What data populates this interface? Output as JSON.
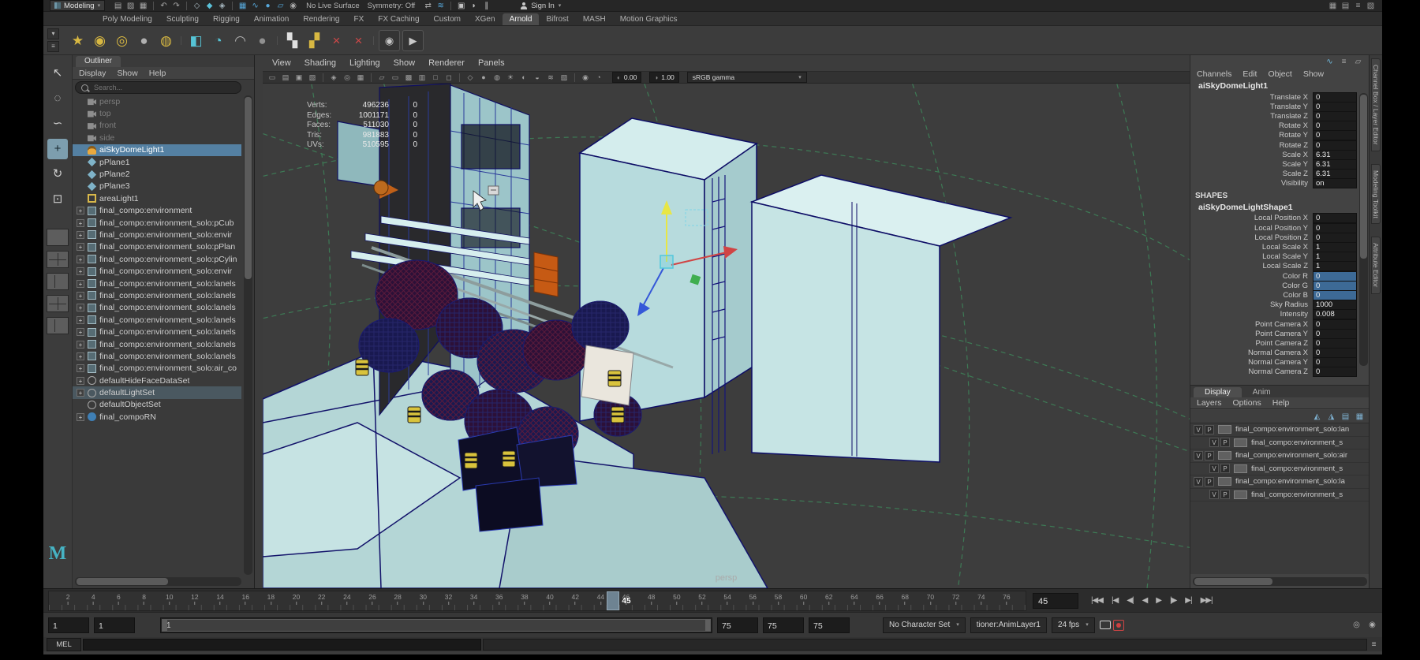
{
  "titlebar": {
    "workspace_selector": "Modeling",
    "no_live_surface": "No Live Surface",
    "symmetry_label": "Symmetry: Off",
    "sign_in_label": "Sign In"
  },
  "titlebar_icons_left": [
    {
      "name": "new-scene-icon",
      "glyph": "▤",
      "color": "#a8a8a8"
    },
    {
      "name": "open-scene-icon",
      "glyph": "▨",
      "color": "#a8a8a8"
    },
    {
      "name": "save-scene-icon",
      "glyph": "▦",
      "color": "#a8a8a8"
    },
    {
      "sep": true
    },
    {
      "name": "undo-icon",
      "glyph": "↶",
      "color": "#a8a8a8"
    },
    {
      "name": "redo-icon",
      "glyph": "↷",
      "color": "#a8a8a8"
    },
    {
      "sep": true
    },
    {
      "name": "select-by-hierarchy-icon",
      "glyph": "◇",
      "color": "#a8b8c0"
    },
    {
      "name": "select-by-object-icon",
      "glyph": "◆",
      "color": "#5bc1d8"
    },
    {
      "name": "select-by-component-icon",
      "glyph": "◈",
      "color": "#a8b8c0"
    },
    {
      "sep": true
    },
    {
      "name": "snap-to-grid-icon",
      "glyph": "▦",
      "color": "#57a9dc"
    },
    {
      "name": "snap-to-curve-icon",
      "glyph": "∿",
      "color": "#57a9dc"
    },
    {
      "name": "snap-to-point-icon",
      "glyph": "●",
      "color": "#57a9dc"
    },
    {
      "name": "snap-to-view-plane-icon",
      "glyph": "▱",
      "color": "#57a9dc"
    },
    {
      "name": "make-live-icon",
      "glyph": "◉",
      "color": "#a8a8a8"
    }
  ],
  "titlebar_icons_mid": [
    {
      "name": "input-connections-icon",
      "glyph": "⇄",
      "color": "#a8a8a8"
    },
    {
      "name": "construction-history-icon",
      "glyph": "≋",
      "color": "#57a9dc"
    },
    {
      "sep": true
    },
    {
      "name": "open-render-view-icon",
      "glyph": "▣",
      "color": "#c4c4c4"
    },
    {
      "name": "render-current-frame-icon",
      "glyph": "◗",
      "color": "#c4c4c4"
    },
    {
      "name": "ipr-render-icon",
      "glyph": "∥",
      "color": "#c4c4c4"
    }
  ],
  "titlebar_icons_right": [
    {
      "name": "layout-grid-icon",
      "glyph": "▦",
      "color": "#a0a0a0"
    },
    {
      "name": "ui-elements-icon",
      "glyph": "▤",
      "color": "#a0a0a0"
    },
    {
      "name": "hotbox-controls-icon",
      "glyph": "≡",
      "color": "#a0a0a0"
    },
    {
      "name": "workspace-icon",
      "glyph": "▧",
      "color": "#a0a0a0"
    }
  ],
  "shelf": {
    "tabs": [
      "Poly Modeling",
      "Sculpting",
      "Rigging",
      "Animation",
      "Rendering",
      "FX",
      "FX Caching",
      "Custom",
      "XGen",
      "Arnold",
      "Bifrost",
      "MASH",
      "Motion Graphics"
    ],
    "active_tab": "Arnold",
    "switch_icons": [
      {
        "name": "shelf-tab-selector-icon",
        "glyph": "▾",
        "color": "#bbbbbb"
      },
      {
        "name": "shelf-menu-icon",
        "glyph": "≡",
        "color": "#bbbbbb"
      }
    ],
    "icons": [
      {
        "name": "poly-sphere-shelf-icon",
        "glyph": "★",
        "color": "#d8b842"
      },
      {
        "name": "poly-cube-shelf-icon",
        "glyph": "◉",
        "color": "#d8b842"
      },
      {
        "name": "poly-torus-shelf-icon",
        "glyph": "◎",
        "color": "#d8b842"
      },
      {
        "name": "poly-plane-shelf-icon",
        "glyph": "●",
        "color": "#b0b0b0"
      },
      {
        "name": "poly-cylinder-shelf-icon",
        "glyph": "◍",
        "color": "#d8b842"
      },
      {
        "sep": true
      },
      {
        "name": "arnold-standin-shelf-icon",
        "glyph": "◧",
        "color": "#56c4d6"
      },
      {
        "name": "arnold-skydome-shelf-icon",
        "glyph": "◔",
        "color": "#56c4d6"
      },
      {
        "name": "arnold-curve-shelf-icon",
        "glyph": "◠",
        "color": "#b0b0b0"
      },
      {
        "name": "arnold-sphere-shelf-icon",
        "glyph": "●",
        "color": "#909090"
      },
      {
        "sep": true
      },
      {
        "name": "uv-checker-shelf-icon",
        "glyph": "▚",
        "color": "#e0e0e0"
      },
      {
        "name": "uv-checker-gold-shelf-icon",
        "glyph": "▞",
        "color": "#d8b842"
      },
      {
        "name": "delete-history-shelf-icon",
        "glyph": "×",
        "color": "#d04848"
      },
      {
        "name": "delete-nondeformer-shelf-icon",
        "glyph": "×",
        "color": "#d04848"
      },
      {
        "sep": true
      },
      {
        "name": "eye-shelf-icon",
        "glyph": "◉",
        "color": "#c8c8c8",
        "cls": "boxed"
      },
      {
        "name": "playblast-shelf-icon",
        "glyph": "▶",
        "color": "#c8c8c8",
        "cls": "boxed"
      }
    ]
  },
  "toolbox": {
    "tools": [
      {
        "name": "select-tool",
        "glyph": "↖"
      },
      {
        "name": "lasso-select-tool",
        "glyph": "◌"
      },
      {
        "name": "paint-select-tool",
        "glyph": "∽"
      },
      {
        "name": "move-tool",
        "glyph": "+"
      },
      {
        "name": "rotate-tool",
        "glyph": "↻"
      },
      {
        "name": "scale-tool",
        "glyph": "⊡"
      }
    ],
    "selected_tool": "move-tool",
    "layout_buttons": [
      {
        "name": "layout-single-pane-button"
      },
      {
        "name": "layout-four-pane-button"
      },
      {
        "name": "layout-two-pane-button"
      },
      {
        "name": "layout-persp-outliner-button"
      },
      {
        "name": "layout-hypershade-button"
      }
    ],
    "logo_text": "M"
  },
  "outliner": {
    "tab_title": "Outliner",
    "menus": [
      "Display",
      "Show",
      "Help"
    ],
    "search_placeholder": "Search...",
    "items": [
      {
        "label": "persp",
        "icon": "camera",
        "dimmed": true
      },
      {
        "label": "top",
        "icon": "camera",
        "dimmed": true
      },
      {
        "label": "front",
        "icon": "camera",
        "dimmed": true
      },
      {
        "label": "side",
        "icon": "camera",
        "dimmed": true
      },
      {
        "label": "aiSkyDomeLight1",
        "icon": "dome-light",
        "selected": true
      },
      {
        "label": "pPlane1",
        "icon": "plane"
      },
      {
        "label": "pPlane2",
        "icon": "plane"
      },
      {
        "label": "pPlane3",
        "icon": "plane"
      },
      {
        "label": "areaLight1",
        "icon": "area-light"
      },
      {
        "label": "final_compo:environment",
        "icon": "transform",
        "expandable": true
      },
      {
        "label": "final_compo:environment_solo:pCub",
        "icon": "transform",
        "expandable": true
      },
      {
        "label": "final_compo:environment_solo:envir",
        "icon": "transform",
        "expandable": true
      },
      {
        "label": "final_compo:environment_solo:pPlan",
        "icon": "transform",
        "expandable": true
      },
      {
        "label": "final_compo:environment_solo:pCylin",
        "icon": "transform",
        "expandable": true
      },
      {
        "label": "final_compo:environment_solo:envir",
        "icon": "transform",
        "expandable": true
      },
      {
        "label": "final_compo:environment_solo:lanels",
        "icon": "transform",
        "expandable": true
      },
      {
        "label": "final_compo:environment_solo:lanels",
        "icon": "transform",
        "expandable": true
      },
      {
        "label": "final_compo:environment_solo:lanels",
        "icon": "transform",
        "expandable": true
      },
      {
        "label": "final_compo:environment_solo:lanels",
        "icon": "transform",
        "expandable": true
      },
      {
        "label": "final_compo:environment_solo:lanels",
        "icon": "transform",
        "expandable": true
      },
      {
        "label": "final_compo:environment_solo:lanels",
        "icon": "transform",
        "expandable": true
      },
      {
        "label": "final_compo:environment_solo:lanels",
        "icon": "transform",
        "expandable": true
      },
      {
        "label": "final_compo:environment_solo:air_co",
        "icon": "transform",
        "expandable": true
      },
      {
        "label": "defaultHideFaceDataSet",
        "icon": "set",
        "expandable": true
      },
      {
        "label": "defaultLightSet",
        "icon": "set",
        "expandable": true,
        "highlighted": true
      },
      {
        "label": "defaultObjectSet",
        "icon": "set"
      },
      {
        "label": "final_compoRN",
        "icon": "reference",
        "expandable": true
      }
    ]
  },
  "viewport": {
    "menus": [
      "View",
      "Shading",
      "Lighting",
      "Show",
      "Renderer",
      "Panels"
    ],
    "toolbar_icons": [
      {
        "name": "camera-lock-icon",
        "glyph": "▭"
      },
      {
        "name": "camera-attributes-icon",
        "glyph": "▤"
      },
      {
        "name": "bookmarks-icon",
        "glyph": "▣"
      },
      {
        "name": "image-plane-icon",
        "glyph": "▧"
      },
      {
        "sep": true
      },
      {
        "name": "two-d-pan-zoom-icon",
        "glyph": "◈"
      },
      {
        "name": "grease-pencil-icon",
        "glyph": "◎"
      },
      {
        "name": "grid-icon",
        "glyph": "▦"
      },
      {
        "sep": true
      },
      {
        "name": "film-gate-icon",
        "glyph": "▱"
      },
      {
        "name": "resolution-gate-icon",
        "glyph": "▭"
      },
      {
        "name": "gate-mask-icon",
        "glyph": "▩"
      },
      {
        "name": "field-chart-icon",
        "glyph": "▥"
      },
      {
        "name": "safe-action-icon",
        "glyph": "□"
      },
      {
        "name": "safe-title-icon",
        "glyph": "◻"
      },
      {
        "sep": true
      },
      {
        "name": "wireframe-icon",
        "glyph": "◇"
      },
      {
        "name": "smooth-shade-icon",
        "glyph": "●"
      },
      {
        "name": "textured-icon",
        "glyph": "◍"
      },
      {
        "name": "use-all-lights-icon",
        "glyph": "☀"
      },
      {
        "name": "shadows-icon",
        "glyph": "◐"
      },
      {
        "name": "screen-space-ao-icon",
        "glyph": "◒"
      },
      {
        "name": "motion-blur-icon",
        "glyph": "≋"
      },
      {
        "name": "multisample-icon",
        "glyph": "▨"
      },
      {
        "sep": true
      },
      {
        "name": "isolate-select-icon",
        "glyph": "◉"
      },
      {
        "name": "xray-icon",
        "glyph": "◔"
      }
    ],
    "toolbar_fields": {
      "exposure": "0.00",
      "gamma": "1.00",
      "view_transform": "sRGB gamma"
    },
    "hud": [
      {
        "label": "Verts:",
        "value": "496236",
        "selected": "0"
      },
      {
        "label": "Edges:",
        "value": "1001171",
        "selected": "0"
      },
      {
        "label": "Faces:",
        "value": "511030",
        "selected": "0"
      },
      {
        "label": "Tris:",
        "value": "981883",
        "selected": "0"
      },
      {
        "label": "UVs:",
        "value": "510595",
        "selected": "0"
      }
    ],
    "camera_label": "persp"
  },
  "channel_box": {
    "header_icons": [
      {
        "name": "channel-stats-icon",
        "glyph": "∿",
        "color": "#6fb6d8"
      },
      {
        "name": "channel-settings-icon",
        "glyph": "≡",
        "color": "#a8a8a8"
      },
      {
        "name": "channel-pin-icon",
        "glyph": "▱",
        "color": "#a8a8a8"
      }
    ],
    "menus": [
      "Channels",
      "Edit",
      "Object",
      "Show"
    ],
    "node_name": "aiSkyDomeLight1",
    "attributes": [
      {
        "name": "Translate X",
        "value": "0"
      },
      {
        "name": "Translate Y",
        "value": "0"
      },
      {
        "name": "Translate Z",
        "value": "0"
      },
      {
        "name": "Rotate X",
        "value": "0"
      },
      {
        "name": "Rotate Y",
        "value": "0"
      },
      {
        "name": "Rotate Z",
        "value": "0"
      },
      {
        "name": "Scale X",
        "value": "6.31"
      },
      {
        "name": "Scale Y",
        "value": "6.31"
      },
      {
        "name": "Scale Z",
        "value": "6.31"
      },
      {
        "name": "Visibility",
        "value": "on"
      }
    ],
    "shapes_heading": "SHAPES",
    "shape_node_name": "aiSkyDomeLightShape1",
    "shape_attributes": [
      {
        "name": "Local Position X",
        "value": "0"
      },
      {
        "name": "Local Position Y",
        "value": "0"
      },
      {
        "name": "Local Position Z",
        "value": "0"
      },
      {
        "name": "Local Scale X",
        "value": "1"
      },
      {
        "name": "Local Scale Y",
        "value": "1"
      },
      {
        "name": "Local Scale Z",
        "value": "1"
      },
      {
        "name": "Color R",
        "value": "0",
        "highlight": true
      },
      {
        "name": "Color G",
        "value": "0",
        "highlight": true
      },
      {
        "name": "Color B",
        "value": "0",
        "highlight": true
      },
      {
        "name": "Sky Radius",
        "value": "1000"
      },
      {
        "name": "Intensity",
        "value": "0.008"
      },
      {
        "name": "Point Camera X",
        "value": "0"
      },
      {
        "name": "Point Camera Y",
        "value": "0"
      },
      {
        "name": "Point Camera Z",
        "value": "0"
      },
      {
        "name": "Normal Camera X",
        "value": "0"
      },
      {
        "name": "Normal Camera Y",
        "value": "0"
      },
      {
        "name": "Normal Camera Z",
        "value": "0"
      }
    ]
  },
  "layer_editor": {
    "tabs": [
      "Display",
      "Anim"
    ],
    "active_tab": "Display",
    "menus": [
      "Layers",
      "Options",
      "Help"
    ],
    "toolbar_icons": [
      {
        "name": "move-layer-up-icon",
        "glyph": "◭"
      },
      {
        "name": "move-layer-down-icon",
        "glyph": "◮"
      },
      {
        "name": "new-empty-layer-icon",
        "glyph": "▤"
      },
      {
        "name": "new-layer-from-selected-icon",
        "glyph": "▦"
      }
    ],
    "layers": [
      {
        "visible": "V",
        "playback": "P",
        "label": "final_compo:environment_solo:lan"
      },
      {
        "visible": "V",
        "playback": "P",
        "label": "final_compo:environment_s",
        "indent": true
      },
      {
        "visible": "V",
        "playback": "P",
        "label": "final_compo:environment_solo:air"
      },
      {
        "visible": "V",
        "playback": "P",
        "label": "final_compo:environment_s",
        "indent": true
      },
      {
        "visible": "V",
        "playback": "P",
        "label": "final_compo:environment_solo:la"
      },
      {
        "visible": "V",
        "playback": "P",
        "label": "final_compo:environment_s",
        "indent": true
      }
    ]
  },
  "side_tabs": [
    "Channel Box / Layer Editor",
    "Modeling Toolkit",
    "Attribute Editor"
  ],
  "timeline": {
    "tick_labels": [
      2,
      4,
      6,
      8,
      10,
      12,
      14,
      16,
      18,
      20,
      22,
      24,
      26,
      28,
      30,
      32,
      34,
      36,
      38,
      40,
      42,
      44,
      46,
      48,
      50,
      52,
      54,
      56,
      58,
      60,
      62,
      64,
      66,
      68,
      70,
      72,
      74,
      76
    ],
    "display_range": [
      1,
      77
    ],
    "current_frame": 45,
    "current_frame_field": "45",
    "playback_buttons": [
      {
        "name": "go-to-start-button",
        "glyph": "|◀◀",
        "color": "#b6b6b6"
      },
      {
        "name": "step-back-frame-button",
        "glyph": "|◀",
        "color": "#b6b6b6"
      },
      {
        "name": "step-back-key-button",
        "glyph": "◀|",
        "color": "#b6b6b6"
      },
      {
        "name": "play-backwards-button",
        "glyph": "◀",
        "color": "#b6b6b6"
      },
      {
        "name": "play-forwards-button",
        "glyph": "▶",
        "color": "#b6b6b6"
      },
      {
        "name": "step-forward-key-button",
        "glyph": "|▶",
        "color": "#b6b6b6"
      },
      {
        "name": "step-forward-frame-button",
        "glyph": "▶|",
        "color": "#b6b6b6"
      },
      {
        "name": "go-to-end-button",
        "glyph": "▶▶|",
        "color": "#b6b6b6"
      }
    ]
  },
  "range_slider": {
    "playback_start": "1",
    "animation_start": "1",
    "handle_label": "1",
    "playback_end": "75",
    "animation_end": "75",
    "end_field": "75",
    "character_set": "No Character Set",
    "anim_layer": "tioner:AnimLayer1",
    "fps": "24 fps",
    "icons": [
      {
        "name": "comment-bubble-icon",
        "cls": "bubble"
      },
      {
        "name": "auto-keyframe-icon",
        "cls": "autokey"
      }
    ],
    "icons_right": [
      {
        "name": "playback-options-icon",
        "glyph": "◎",
        "color": "#b0b0b0"
      },
      {
        "name": "animation-preferences-icon",
        "glyph": "◉",
        "color": "#b0b0b0"
      }
    ]
  },
  "command_line": {
    "mode_label": "MEL",
    "icons": [
      {
        "name": "script-editor-icon",
        "glyph": "≡",
        "color": "#b8b8b8"
      }
    ]
  },
  "accent_colors": {
    "selection_blue": "#5480a2",
    "wireframe_blue": "#12126a",
    "mesh_teal": "#bcdcdc",
    "grid_green": "#3e8f5e",
    "manipulator_yellow": "#e8e645",
    "manipulator_red": "#d04444",
    "manipulator_blue": "#3558d8"
  }
}
